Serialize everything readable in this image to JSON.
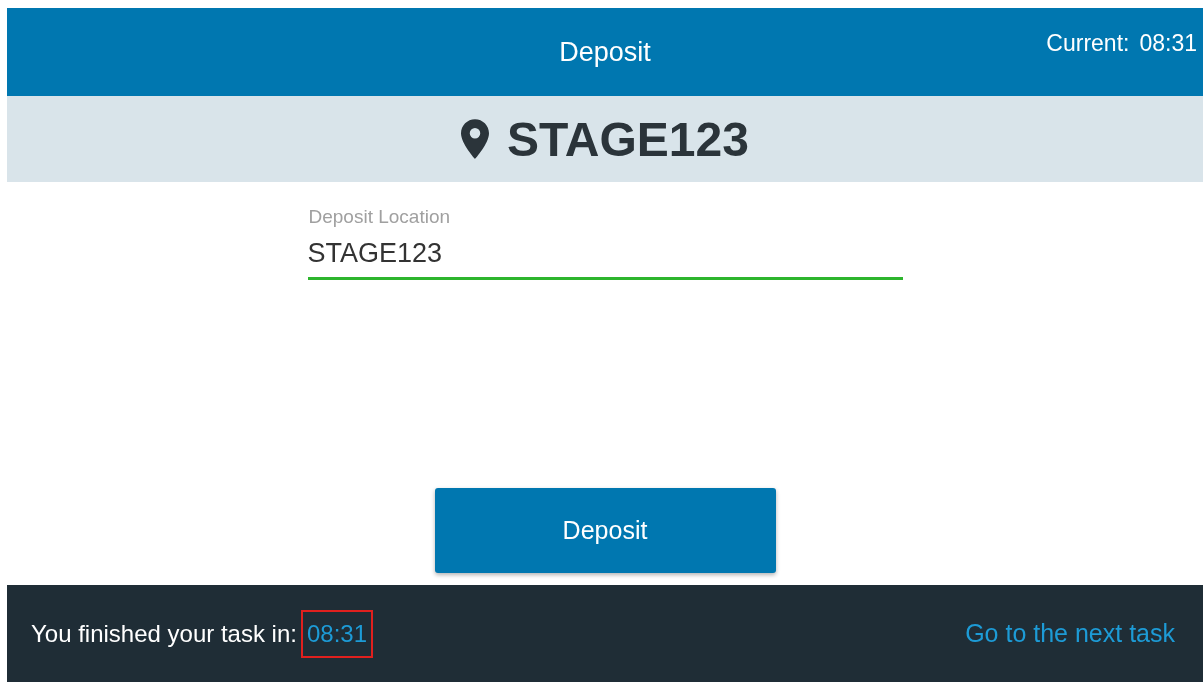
{
  "header": {
    "title": "Deposit",
    "clock_label": "Current:",
    "clock_value": "08:31"
  },
  "location": {
    "name": "STAGE123"
  },
  "field": {
    "label": "Deposit Location",
    "value": "STAGE123",
    "valid": true
  },
  "action_button": {
    "label": "Deposit"
  },
  "footer": {
    "message": "You finished your task in:",
    "time": "08:31",
    "time_highlighted": true,
    "link": "Go to the next task"
  }
}
